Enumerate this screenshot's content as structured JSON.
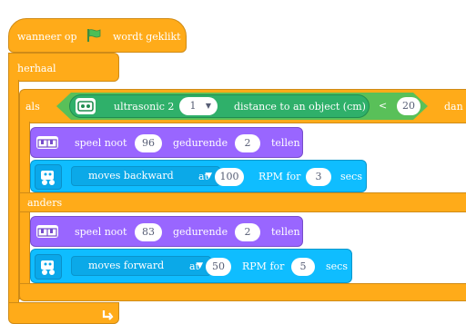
{
  "hat": {
    "prefix": "wanneer op",
    "suffix": "wordt geklikt",
    "flag_icon": "green-flag-icon"
  },
  "loop": {
    "label": "herhaal",
    "loop_icon": "loop-arrow-icon"
  },
  "if_block": {
    "label": "als",
    "else_label": "anders",
    "condition": {
      "sensor_label": "ultrasonic 2",
      "sensor_index": "1",
      "measure_label": "distance to an object (cm)",
      "operator": "<",
      "threshold": "20",
      "trailing_text": "dan"
    }
  },
  "then_branch": {
    "note": {
      "prefix": "speel noot",
      "note": "96",
      "middle": "gedurende",
      "beats": "2",
      "suffix": "tellen"
    },
    "motor": {
      "direction": "moves backward",
      "at": "at",
      "rpm": "100",
      "rpm_for": "RPM for",
      "secs": "3",
      "unit": "secs"
    }
  },
  "else_branch": {
    "note": {
      "prefix": "speel noot",
      "note": "83",
      "middle": "gedurende",
      "beats": "2",
      "suffix": "tellen"
    },
    "motor": {
      "direction": "moves forward",
      "at": "at",
      "rpm": "50",
      "rpm_for": "RPM for",
      "secs": "5",
      "unit": "secs"
    }
  },
  "colors": {
    "events": "#ffab19",
    "control": "#ffab19",
    "sound": "#9966ff",
    "motion_ext": "#0fbdff",
    "sensor_ext": "#59c059"
  }
}
